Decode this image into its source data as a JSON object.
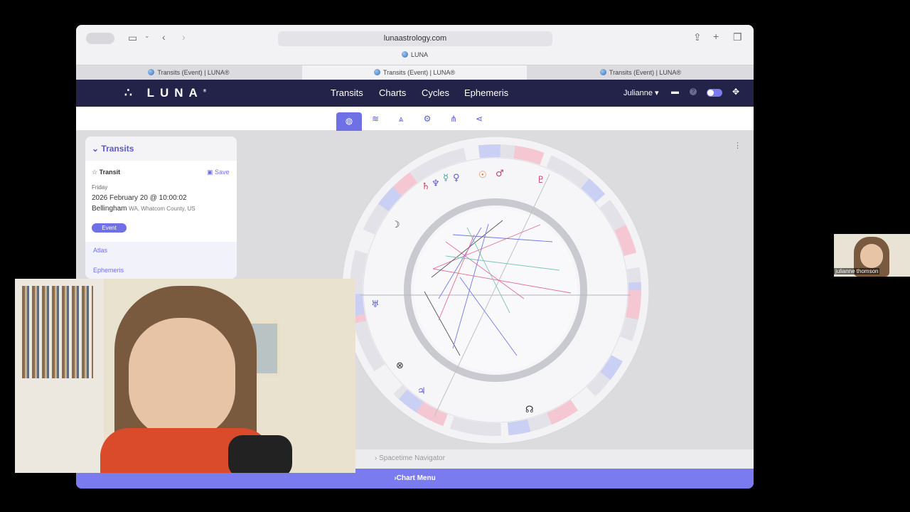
{
  "browser": {
    "url": "lunaastrology.com",
    "window_title": "LUNA",
    "tabs": [
      {
        "label": "Transits (Event) | LUNA®"
      },
      {
        "label": "Transits (Event) | LUNA®"
      },
      {
        "label": "Transits (Event) | LUNA®"
      }
    ]
  },
  "nav": {
    "logo": "LUNA",
    "logo_mark": "∴",
    "links": [
      "Transits",
      "Charts",
      "Cycles",
      "Ephemeris"
    ],
    "user": "Julianne"
  },
  "panel": {
    "title": "Transits",
    "transit_label": "Transit",
    "save_label": "Save",
    "day": "Friday",
    "datetime": "2026 February 20 @ 10:00:02",
    "location_city": "Bellingham",
    "location_detail": "WA, Whatcom County, US",
    "badge": "Event",
    "links": [
      "Atlas",
      "Ephemeris"
    ]
  },
  "footer": {
    "spacetime": "Spacetime Navigator",
    "chart_menu": "Chart Menu"
  },
  "participant": {
    "name": "julianne thomson"
  },
  "colors": {
    "navbar": "#23234a",
    "accent": "#7b7bf0"
  }
}
